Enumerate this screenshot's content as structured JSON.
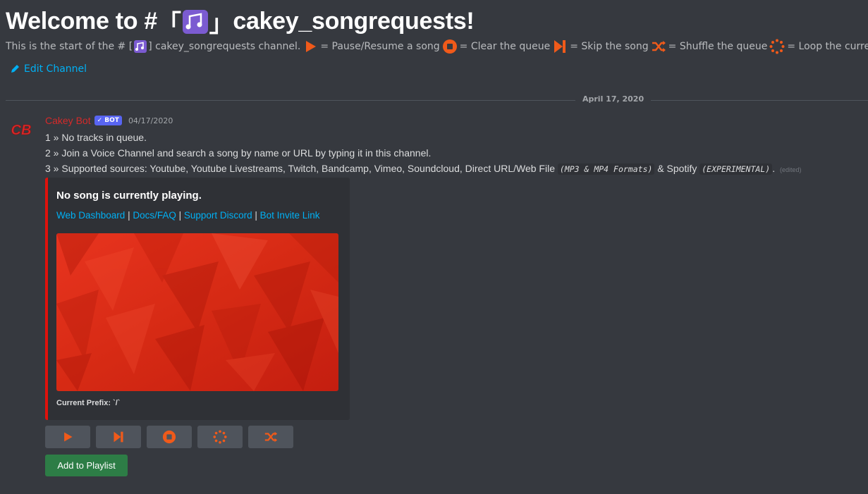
{
  "channel": {
    "welcome_prefix": "Welcome to #",
    "name": "cakey_songrequests",
    "welcome_suffix": "!",
    "desc_start": "This is the start of the #",
    "desc_channel": "cakey_songrequests channel.",
    "legend": {
      "pause": "= Pause/Resume a song",
      "clear": "= Clear the queue",
      "skip": "= Skip the song",
      "shuffle": "= Shuffle the queue",
      "loop": "= Loop the current song"
    },
    "edit_label": "Edit Channel"
  },
  "divider": {
    "date": "April 17, 2020"
  },
  "message": {
    "author": "Cakey Bot",
    "avatar_text": "CB",
    "bot_tag": "BOT",
    "timestamp": "04/17/2020",
    "line1": "1 » No tracks in queue.",
    "line2": "2 » Join a Voice Channel and search a song by name or URL by typing it in this channel.",
    "line3_start": "3 » Supported sources: Youtube, Youtube Livestreams, Twitch, Bandcamp, Vimeo, Soundcloud, Direct URL/Web File",
    "line3_code1": "(MP3 & MP4 Formats)",
    "line3_mid": "& Spotify",
    "line3_code2": "(EXPERIMENTAL)",
    "line3_end": ".",
    "edited": "(edited)"
  },
  "embed": {
    "title": "No song is currently playing.",
    "links": [
      "Web Dashboard",
      "Docs/FAQ",
      "Support Discord",
      "Bot Invite Link"
    ],
    "separator": " | ",
    "footer": "Current Prefix: `/`",
    "accent_color": "#e0120c"
  },
  "buttons": {
    "controls": [
      "play-pause-icon",
      "skip-icon",
      "stop-icon",
      "loop-icon",
      "shuffle-icon"
    ],
    "playlist_label": "Add to Playlist"
  },
  "colors": {
    "background": "#36393f",
    "link": "#00b0f4",
    "username": "#d42a2a",
    "icon_orange": "#f05a1a",
    "playlist_button": "#2d7d46"
  }
}
